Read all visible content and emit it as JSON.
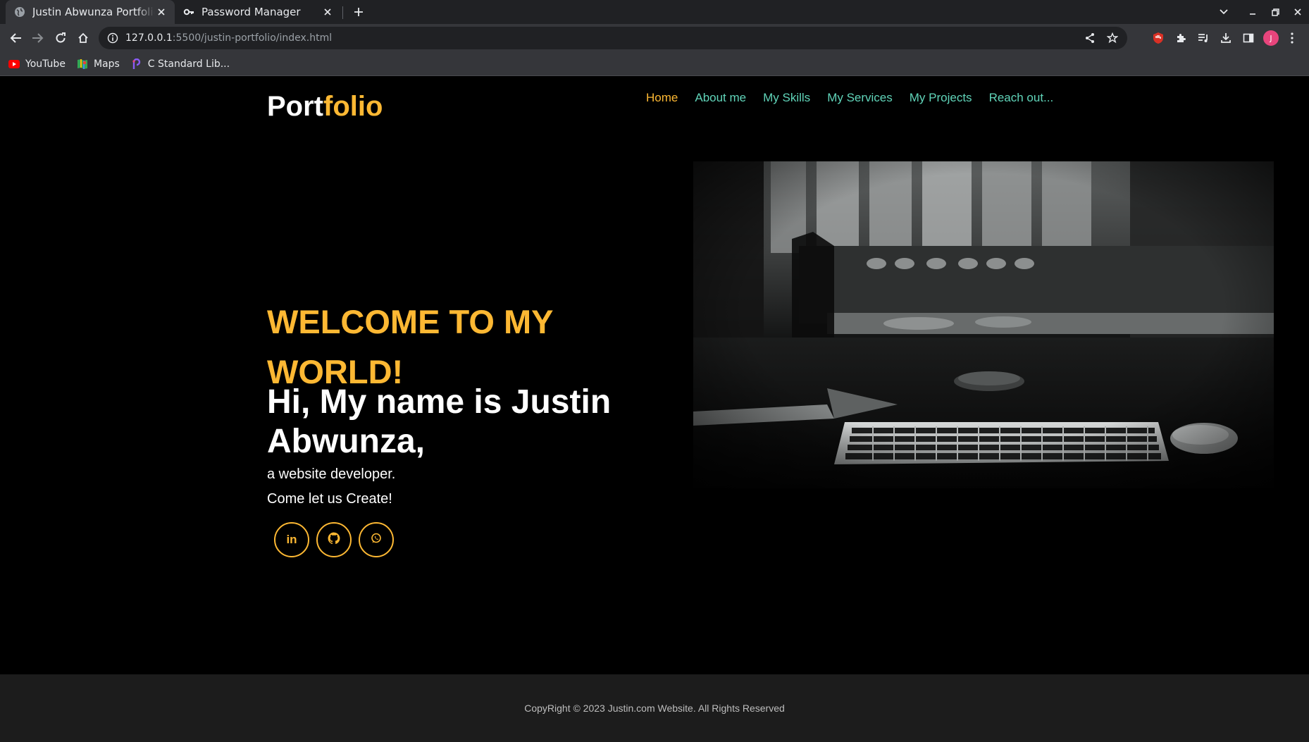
{
  "browser": {
    "tabs": [
      {
        "title": "Justin Abwunza Portfolio",
        "icon": "globe-icon"
      },
      {
        "title": "Password Manager",
        "icon": "key-icon"
      }
    ],
    "url_host": "127.0.0.1",
    "url_rest": ":5500/justin-portfolio/index.html",
    "avatar_letter": "J",
    "bookmarks": [
      {
        "label": "YouTube",
        "icon": "youtube-icon"
      },
      {
        "label": "Maps",
        "icon": "maps-icon"
      },
      {
        "label": "C Standard Lib...",
        "icon": "bookmark-favicon-icon"
      }
    ]
  },
  "site": {
    "logo_main": "Port",
    "logo_accent": "folio",
    "nav": [
      "Home",
      "About me",
      "My Skills",
      "My Services",
      "My Projects",
      "Reach out..."
    ],
    "active_nav": "Home",
    "hero": {
      "welcome": "WELCOME TO MY WORLD!",
      "name_line": "Hi, My name is Justin Abwunza,",
      "role": "a website developer.",
      "tagline": "Come let us Create!",
      "socials": [
        {
          "label": "in",
          "icon": "linkedin-icon"
        },
        {
          "label": "",
          "icon": "github-icon"
        },
        {
          "label": "",
          "icon": "whatsapp-icon"
        }
      ]
    },
    "footer": "CopyRight © 2023 Justin.com Website. All Rights Reserved"
  },
  "colors": {
    "accent": "#fdb833",
    "nav_link": "#60d4b9",
    "background": "#000000",
    "footer_bg": "#1c1c1c"
  }
}
